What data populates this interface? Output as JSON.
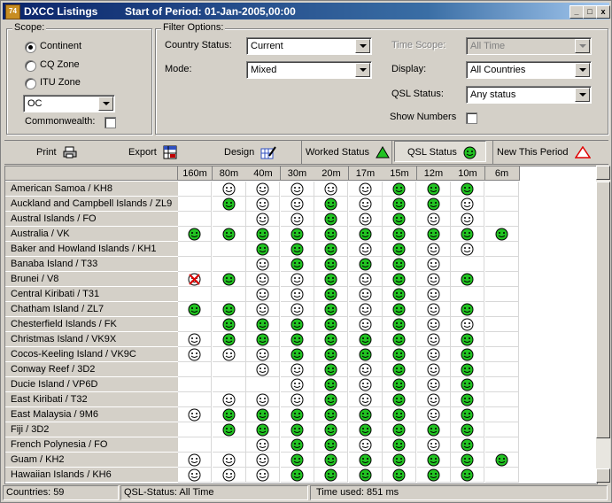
{
  "window": {
    "app_name": "DXCC Listings",
    "title": "Start of Period: 01-Jan-2005,00:00",
    "minimize": "_",
    "maximize": "□",
    "close": "x"
  },
  "scope": {
    "title": "Scope:",
    "options": [
      {
        "label": "Continent",
        "selected": true
      },
      {
        "label": "CQ Zone",
        "selected": false
      },
      {
        "label": "ITU Zone",
        "selected": false
      }
    ],
    "continent_value": "OC",
    "commonwealth_label": "Commonwealth:",
    "commonwealth_checked": false
  },
  "filter": {
    "title": "Filter Options:",
    "country_status_label": "Country Status:",
    "country_status_value": "Current",
    "mode_label": "Mode:",
    "mode_value": "Mixed",
    "time_scope_label": "Time Scope:",
    "time_scope_value": "All Time",
    "display_label": "Display:",
    "display_value": "All Countries",
    "qsl_status_label": "QSL Status:",
    "qsl_status_value": "Any status",
    "show_numbers_label": "Show Numbers",
    "show_numbers_checked": false
  },
  "toolbar": {
    "print": "Print",
    "export": "Export",
    "design": "Design",
    "worked_status": "Worked Status",
    "qsl_status": "QSL Status",
    "new_this_period": "New This Period"
  },
  "colors": {
    "confirmed": "#22c322",
    "worked": "#ffffff",
    "titlebar": "#0a246a",
    "new_period": "#e00000"
  },
  "table": {
    "bands": [
      "160m",
      "80m",
      "40m",
      "30m",
      "20m",
      "17m",
      "15m",
      "12m",
      "10m",
      "6m"
    ],
    "legend": {
      "G": "confirmed",
      "W": "worked",
      "X": "deleted"
    },
    "rows": [
      {
        "name": "American Samoa / KH8",
        "marks": [
          "",
          "W",
          "W",
          "W",
          "W",
          "W",
          "G",
          "G",
          "G",
          ""
        ]
      },
      {
        "name": "Auckland and Campbell Islands / ZL9",
        "marks": [
          "",
          "G",
          "W",
          "W",
          "G",
          "W",
          "G",
          "G",
          "W",
          ""
        ]
      },
      {
        "name": "Austral Islands / FO",
        "marks": [
          "",
          "",
          "W",
          "W",
          "G",
          "W",
          "G",
          "W",
          "W",
          ""
        ]
      },
      {
        "name": "Australia / VK",
        "marks": [
          "G",
          "G",
          "G",
          "G",
          "G",
          "G",
          "G",
          "G",
          "G",
          "G"
        ]
      },
      {
        "name": "Baker and Howland Islands / KH1",
        "marks": [
          "",
          "",
          "G",
          "G",
          "G",
          "W",
          "G",
          "W",
          "W",
          ""
        ]
      },
      {
        "name": "Banaba Island / T33",
        "marks": [
          "",
          "",
          "W",
          "G",
          "G",
          "G",
          "G",
          "W",
          "",
          ""
        ]
      },
      {
        "name": "Brunei / V8",
        "marks": [
          "X",
          "G",
          "W",
          "W",
          "G",
          "W",
          "G",
          "W",
          "G",
          ""
        ]
      },
      {
        "name": "Central Kiribati / T31",
        "marks": [
          "",
          "",
          "W",
          "W",
          "G",
          "W",
          "G",
          "W",
          "",
          ""
        ]
      },
      {
        "name": "Chatham Island / ZL7",
        "marks": [
          "G",
          "G",
          "W",
          "W",
          "G",
          "W",
          "G",
          "W",
          "G",
          ""
        ]
      },
      {
        "name": "Chesterfield Islands / FK",
        "marks": [
          "",
          "G",
          "G",
          "G",
          "G",
          "W",
          "G",
          "W",
          "W",
          ""
        ]
      },
      {
        "name": "Christmas Island / VK9X",
        "marks": [
          "W",
          "G",
          "G",
          "G",
          "G",
          "G",
          "G",
          "W",
          "G",
          ""
        ]
      },
      {
        "name": "Cocos-Keeling Island / VK9C",
        "marks": [
          "W",
          "W",
          "W",
          "G",
          "G",
          "G",
          "G",
          "W",
          "G",
          ""
        ]
      },
      {
        "name": "Conway Reef / 3D2",
        "marks": [
          "",
          "",
          "W",
          "W",
          "G",
          "W",
          "G",
          "W",
          "G",
          ""
        ]
      },
      {
        "name": "Ducie Island / VP6D",
        "marks": [
          "",
          "",
          "",
          "W",
          "G",
          "W",
          "G",
          "W",
          "G",
          ""
        ]
      },
      {
        "name": "East Kiribati / T32",
        "marks": [
          "",
          "W",
          "W",
          "W",
          "G",
          "W",
          "G",
          "W",
          "G",
          ""
        ]
      },
      {
        "name": "East Malaysia / 9M6",
        "marks": [
          "W",
          "G",
          "G",
          "G",
          "G",
          "G",
          "G",
          "W",
          "G",
          ""
        ]
      },
      {
        "name": "Fiji / 3D2",
        "marks": [
          "",
          "G",
          "G",
          "G",
          "G",
          "G",
          "G",
          "G",
          "G",
          ""
        ]
      },
      {
        "name": "French Polynesia / FO",
        "marks": [
          "",
          "",
          "W",
          "G",
          "G",
          "W",
          "G",
          "W",
          "G",
          ""
        ]
      },
      {
        "name": "Guam / KH2",
        "marks": [
          "W",
          "W",
          "W",
          "G",
          "G",
          "G",
          "G",
          "G",
          "G",
          "G"
        ]
      },
      {
        "name": "Hawaiian Islands / KH6",
        "marks": [
          "W",
          "W",
          "W",
          "G",
          "G",
          "G",
          "G",
          "G",
          "G",
          ""
        ]
      }
    ]
  },
  "statusbar": {
    "countries": "Countries: 59",
    "qsl_status": "QSL-Status: All Time",
    "time_used": "Time used: 851 ms"
  }
}
